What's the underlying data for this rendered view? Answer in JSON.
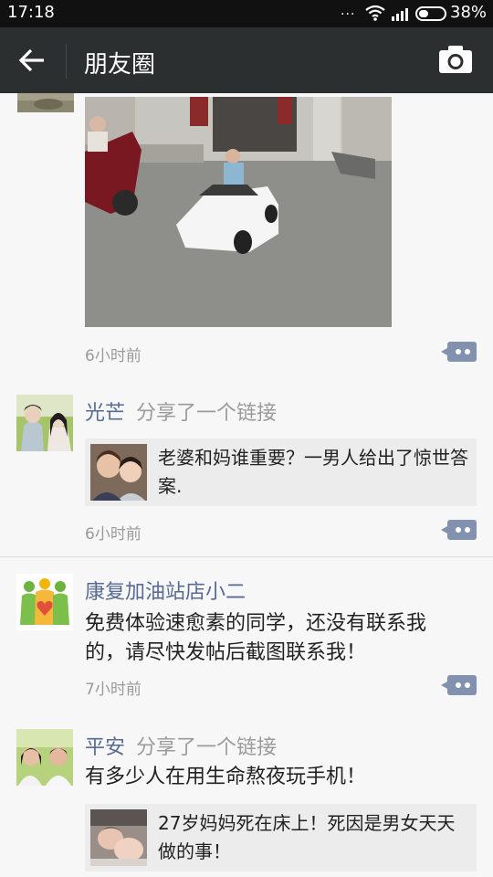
{
  "status": {
    "time": "17:18",
    "dots": "...",
    "battery": "38%"
  },
  "nav": {
    "title": "朋友圈"
  },
  "posts": [
    {
      "time": "6小时前"
    },
    {
      "name": "光芒",
      "action": "分享了一个链接",
      "link_title": "老婆和妈谁重要？一男人给出了惊世答案.",
      "time": "6小时前"
    },
    {
      "name": "康复加油站店小二",
      "text": "免费体验速愈素的同学，还没有联系我的，请尽快发帖后截图联系我！",
      "time": "7小时前"
    },
    {
      "name": "平安",
      "action": "分享了一个链接",
      "text": "有多少人在用生命熬夜玩手机！",
      "link_title": "27岁妈妈死在床上！死因是男女天天做的事！"
    }
  ],
  "colors": {
    "nav_bg": "#2b2f30",
    "name": "#576b95",
    "comment_btn": "#8291ad"
  }
}
